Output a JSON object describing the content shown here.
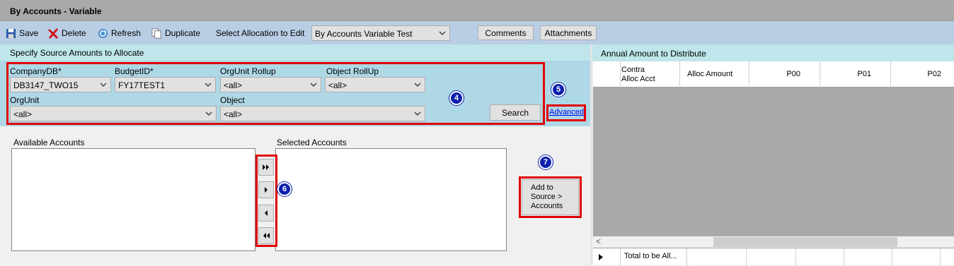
{
  "window": {
    "title": "By Accounts - Variable"
  },
  "toolbar": {
    "save_label": "Save",
    "delete_label": "Delete",
    "refresh_label": "Refresh",
    "duplicate_label": "Duplicate",
    "select_allocation_label": "Select Allocation to Edit",
    "allocation_value": "By Accounts Variable Test",
    "comments_label": "Comments",
    "attachments_label": "Attachments"
  },
  "source": {
    "header": "Specify Source Amounts to Allocate",
    "company_label": "CompanyDB*",
    "company_value": "DB3147_TWO15",
    "budget_label": "BudgetID*",
    "budget_value": "FY17TEST1",
    "orgunit_rollup_label": "OrgUnit Rollup",
    "orgunit_rollup_value": "<all>",
    "object_rollup_label": "Object RollUp",
    "object_rollup_value": "<all>",
    "orgunit_label": "OrgUnit",
    "orgunit_value": "<all>",
    "object_label": "Object",
    "object_value": "<all>",
    "search_label": "Search",
    "advanced_label": "Advanced"
  },
  "accounts": {
    "available_label": "Available Accounts",
    "selected_label": "Selected Accounts",
    "add_to_source_label": "Add to\nSource  >\nAccounts"
  },
  "badges": {
    "b4": "4",
    "b5": "5",
    "b6": "6",
    "b7": "7"
  },
  "distribute": {
    "header": "Annual Amount to Distribute",
    "columns": [
      "Contra\nAlloc Acct",
      "Alloc Amount",
      "P00",
      "P01",
      "P02"
    ],
    "footer_label": "Total to be All...",
    "scroll_left": "<"
  },
  "colors": {
    "highlight": "#e00000",
    "badge": "#0c1fae",
    "panel_header": "#bfe6ea",
    "panel_body": "#afd8e6",
    "toolbar": "#b9cde5"
  }
}
